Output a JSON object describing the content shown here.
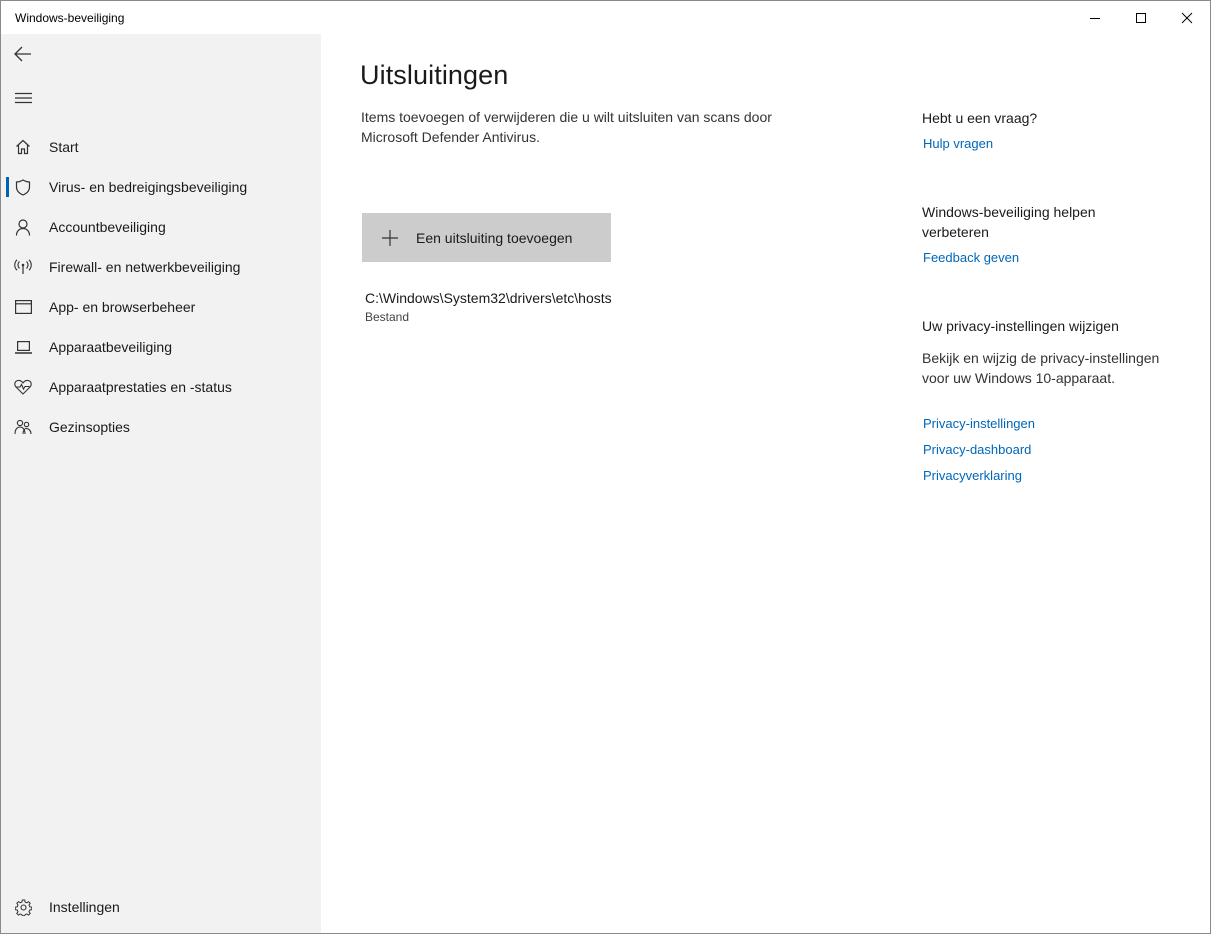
{
  "window": {
    "title": "Windows-beveiliging"
  },
  "sidebar": {
    "items": [
      {
        "label": "Start",
        "icon": "home-icon"
      },
      {
        "label": "Virus- en bedreigingsbeveiliging",
        "icon": "shield-icon",
        "active": true
      },
      {
        "label": "Accountbeveiliging",
        "icon": "person-icon"
      },
      {
        "label": "Firewall- en netwerkbeveiliging",
        "icon": "antenna-icon"
      },
      {
        "label": "App- en browserbeheer",
        "icon": "browser-window-icon"
      },
      {
        "label": "Apparaatbeveiliging",
        "icon": "laptop-icon"
      },
      {
        "label": "Apparaatprestaties en -status",
        "icon": "heart-pulse-icon"
      },
      {
        "label": "Gezinsopties",
        "icon": "family-icon"
      }
    ],
    "settings_label": "Instellingen"
  },
  "main": {
    "title": "Uitsluitingen",
    "description": "Items toevoegen of verwijderen die u wilt uitsluiten van scans door Microsoft Defender Antivirus.",
    "add_button_label": "Een uitsluiting toevoegen",
    "exclusions": [
      {
        "path": "C:\\Windows\\System32\\drivers\\etc\\hosts",
        "type": "Bestand"
      }
    ]
  },
  "side_panel": {
    "question_heading": "Hebt u een vraag?",
    "help_link": "Hulp vragen",
    "improve_heading": "Windows-beveiliging helpen verbeteren",
    "feedback_link": "Feedback geven",
    "privacy_heading": "Uw privacy-instellingen wijzigen",
    "privacy_text": "Bekijk en wijzig de privacy-instellingen voor uw Windows 10-apparaat.",
    "privacy_links": [
      "Privacy-instellingen",
      "Privacy-dashboard",
      "Privacyverklaring"
    ]
  },
  "colors": {
    "accent": "#0063b1",
    "link": "#0067b8",
    "sidebar_bg": "#f2f2f2",
    "button_bg": "#cccccc"
  }
}
